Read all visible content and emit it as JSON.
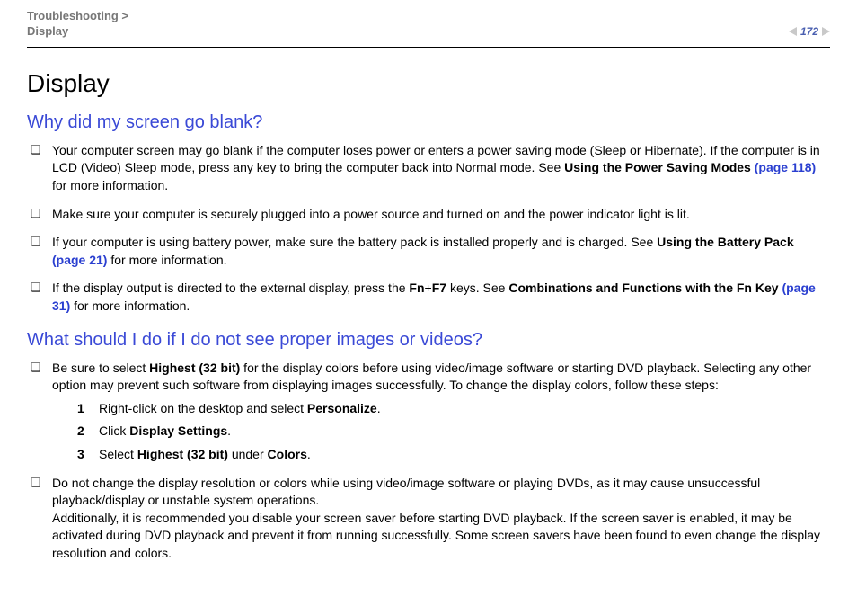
{
  "header": {
    "breadcrumb_line1": "Troubleshooting >",
    "breadcrumb_line2": "Display",
    "page_number": "172"
  },
  "title": "Display",
  "section1": {
    "heading": "Why did my screen go blank?",
    "items": [
      {
        "pre": "Your computer screen may go blank if the computer loses power or enters a power saving mode (Sleep or Hibernate). If the computer is in LCD (Video) Sleep mode, press any key to bring the computer back into Normal mode. See ",
        "bold1": "Using the Power Saving Modes ",
        "link1": "(page 118)",
        "post": " for more information."
      },
      {
        "plain": "Make sure your computer is securely plugged into a power source and turned on and the power indicator light is lit."
      },
      {
        "pre": "If your computer is using battery power, make sure the battery pack is installed properly and is charged. See ",
        "bold1": "Using the Battery Pack ",
        "link1": "(page 21)",
        "post": " for more information."
      },
      {
        "pre": "If the display output is directed to the external display, press the ",
        "bold1": "Fn",
        "mid1": "+",
        "bold2": "F7",
        "mid2": " keys. See ",
        "bold3": "Combinations and Functions with the Fn Key ",
        "link1": "(page 31)",
        "post": " for more information."
      }
    ]
  },
  "section2": {
    "heading": "What should I do if I do not see proper images or videos?",
    "item1": {
      "pre": "Be sure to select ",
      "bold1": "Highest (32 bit)",
      "post": " for the display colors before using video/image software or starting DVD playback. Selecting any other option may prevent such software from displaying images successfully. To change the display colors, follow these steps:"
    },
    "steps": [
      {
        "pre": "Right-click on the desktop and select ",
        "bold": "Personalize",
        "post": "."
      },
      {
        "pre": "Click ",
        "bold": "Display Settings",
        "post": "."
      },
      {
        "pre": "Select ",
        "bold": "Highest (32 bit)",
        "mid": " under ",
        "bold2": "Colors",
        "post": "."
      }
    ],
    "item2": {
      "line1": "Do not change the display resolution or colors while using video/image software or playing DVDs, as it may cause unsuccessful playback/display or unstable system operations.",
      "line2": "Additionally, it is recommended you disable your screen saver before starting DVD playback. If the screen saver is enabled, it may be activated during DVD playback and prevent it from running successfully. Some screen savers have been found to even change the display resolution and colors."
    }
  }
}
